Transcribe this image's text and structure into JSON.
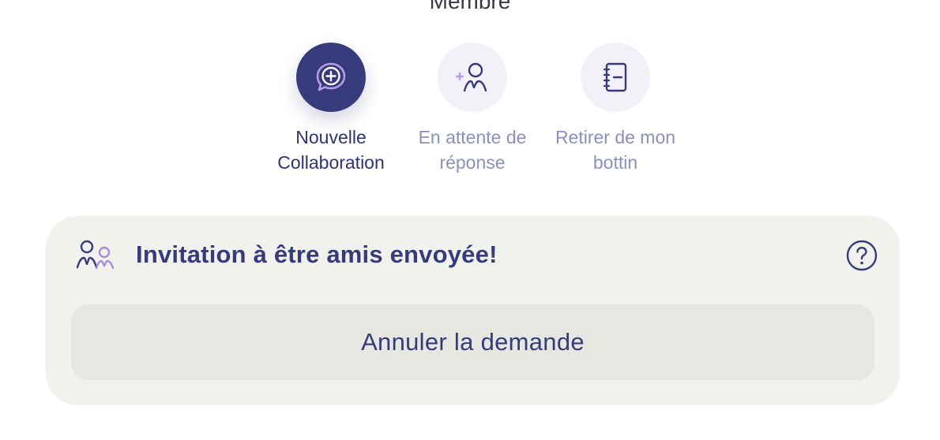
{
  "profile": {
    "member_label": "Membre"
  },
  "actions": [
    {
      "label": "Nouvelle\nCollaboration",
      "icon": "chat-plus-icon",
      "state": "active"
    },
    {
      "label": "En attente de\nréponse",
      "icon": "add-person-icon",
      "state": "inactive"
    },
    {
      "label": "Retirer de mon\nbottin",
      "icon": "notebook-minus-icon",
      "state": "inactive"
    }
  ],
  "invitation_card": {
    "icon": "friends-icon",
    "title": "Invitation à être amis envoyée!",
    "help_icon": "question-circle-icon",
    "cancel_label": "Annuler la demande"
  },
  "colors": {
    "primary": "#373b7c",
    "secondary_text": "#8e8fc0",
    "card_bg": "#f1f1ed",
    "button_bg": "#e7e7e1",
    "accent_purple": "#a98ddb"
  }
}
